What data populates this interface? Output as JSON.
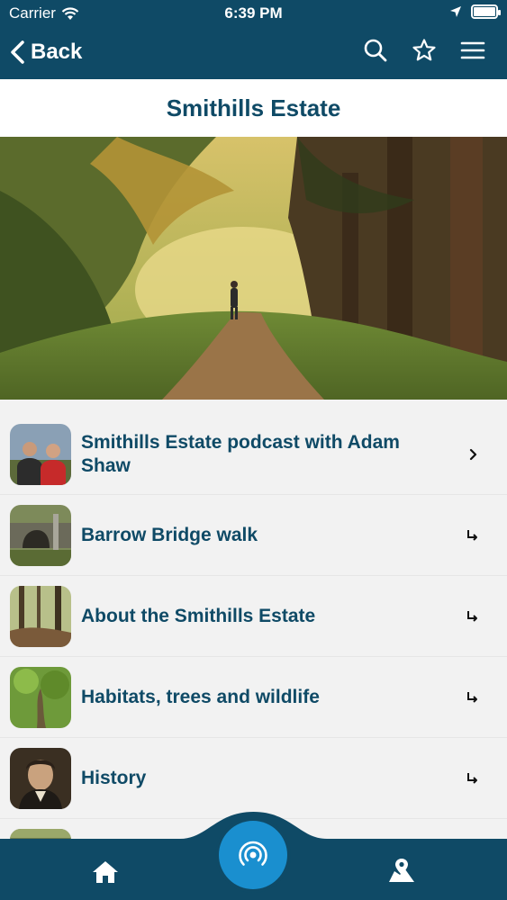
{
  "status_bar": {
    "carrier": "Carrier",
    "time": "6:39 PM"
  },
  "nav": {
    "back_label": "Back",
    "icons": [
      "search-icon",
      "star-icon",
      "menu-icon"
    ]
  },
  "page": {
    "title": "Smithills Estate"
  },
  "list": {
    "items": [
      {
        "label": "Smithills Estate podcast with Adam Shaw",
        "arrow": "chevron-right-icon"
      },
      {
        "label": "Barrow Bridge walk",
        "arrow": "return-arrow-icon"
      },
      {
        "label": "About the Smithills Estate",
        "arrow": "return-arrow-icon"
      },
      {
        "label": "Habitats, trees and wildlife",
        "arrow": "return-arrow-icon"
      },
      {
        "label": "History",
        "arrow": "return-arrow-icon"
      }
    ]
  },
  "tabbar": {
    "icons": [
      "home-icon",
      "radio-waves-icon",
      "map-pin-icon"
    ]
  },
  "colors": {
    "brand": "#0f4a66",
    "accent": "#1a8fcf",
    "background": "#f2f2f2"
  }
}
